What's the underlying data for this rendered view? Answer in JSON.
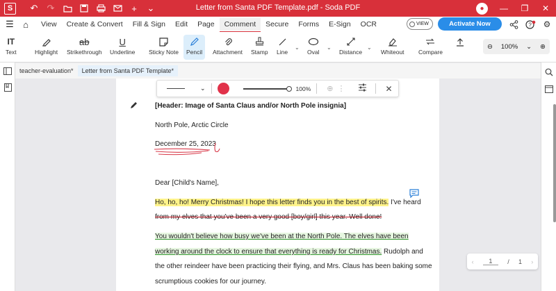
{
  "window": {
    "app_logo": "S",
    "title": "Letter from Santa PDF Template.pdf - Soda PDF"
  },
  "titlebar_icons": [
    "undo-icon",
    "redo-icon",
    "open-folder-icon",
    "save-icon",
    "print-icon",
    "mail-icon",
    "add-icon",
    "chevron-down-icon"
  ],
  "menu": {
    "items": [
      "View",
      "Create & Convert",
      "Fill & Sign",
      "Edit",
      "Page",
      "Comment",
      "Secure",
      "Forms",
      "E-Sign",
      "OCR"
    ],
    "active": "Comment",
    "view_toggle": "VIEW",
    "activate_label": "Activate Now"
  },
  "tools": {
    "text": "Text",
    "highlight": "Highlight",
    "strikethrough": "Strikethrough",
    "underline": "Underline",
    "sticky_note": "Sticky Note",
    "pencil": "Pencil",
    "attachment": "Attachment",
    "stamp": "Stamp",
    "line": "Line",
    "oval": "Oval",
    "distance": "Distance",
    "whiteout": "Whiteout",
    "compare": "Compare",
    "zoom": "100%"
  },
  "tabs": [
    "teacher-evaluation*",
    "Letter from Santa PDF Template*"
  ],
  "pencil_bar": {
    "opacity": "100%",
    "color": "#e1324a"
  },
  "letter": {
    "header": "[Header: Image of Santa Claus and/or North Pole insignia]",
    "location": "North Pole, Arctic Circle",
    "date": "December 25, 2023",
    "greeting": "Dear [Child's Name],",
    "p1_highlight": "Ho, ho, ho! Merry Christmas! I hope this letter finds you in the best of spirits.",
    "p1_rest": " I've heard",
    "p1_strike": "from my elves that you've been a very good [boy/girl] this year. Well done!",
    "p2_l1": "You wouldn't believe how busy we've been at the North Pole. The elves have been",
    "p2_l2_green": "working around the clock to ensure that everything is ready for Christmas.",
    "p2_l2_rest": " Rudolph and",
    "p2_l3": "the other reindeer have been practicing their flying, and Mrs. Claus has been baking some",
    "p2_l4": "scrumptious cookies for our journey."
  },
  "page_counter": {
    "current": "1",
    "separator": "/",
    "total": "1"
  },
  "colors": {
    "brand": "#d8303a",
    "accent": "#2a8de8",
    "highlight_yellow": "#fff38a",
    "strike_red": "#c2131f"
  }
}
